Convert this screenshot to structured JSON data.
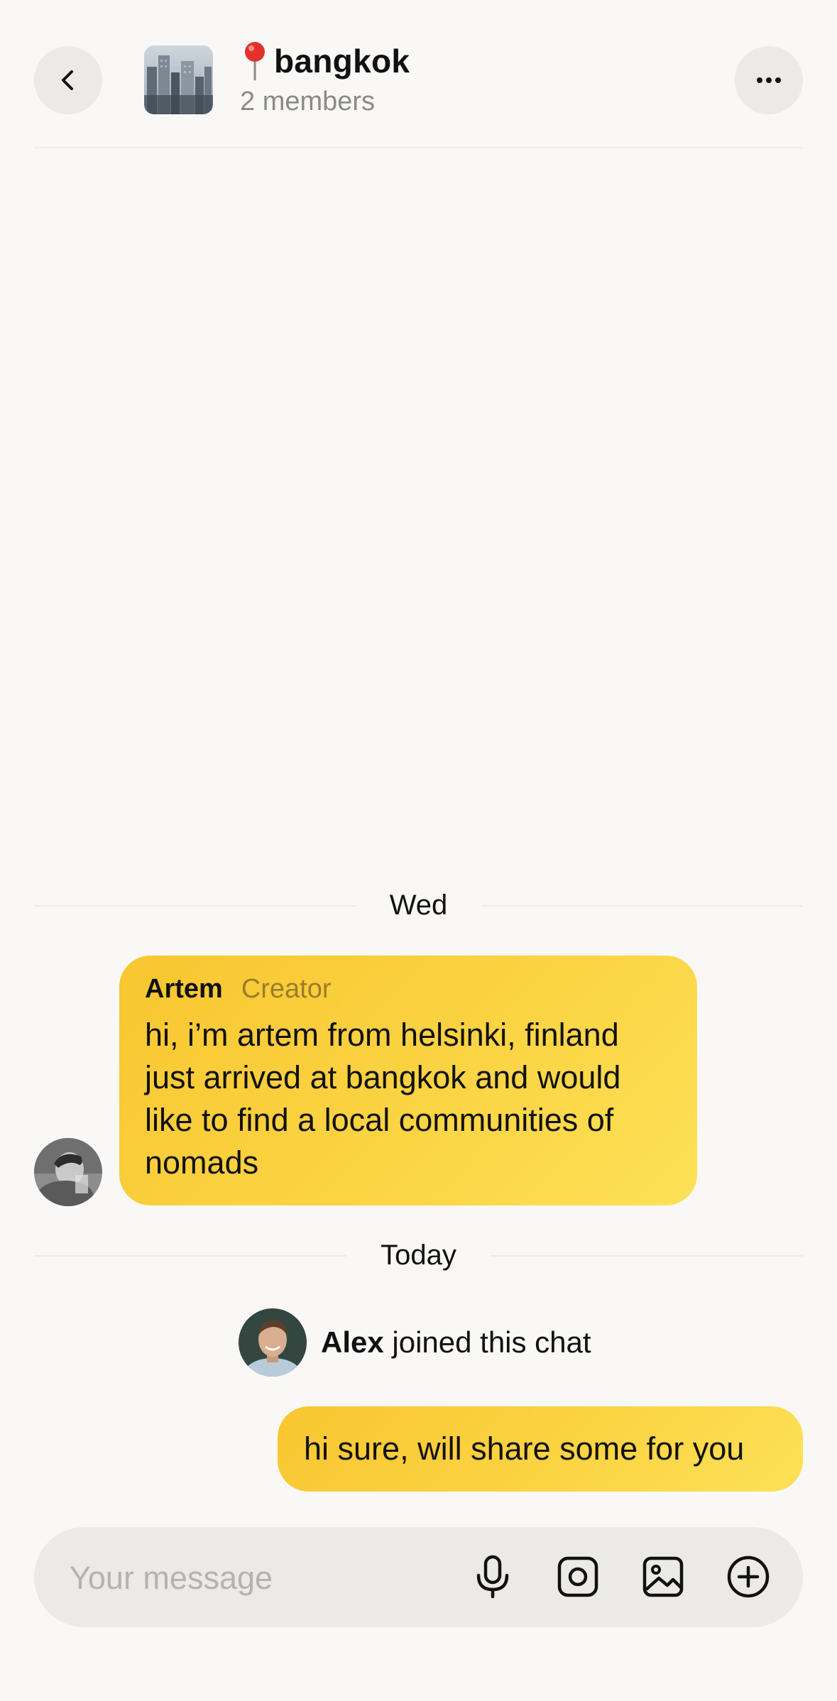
{
  "header": {
    "title": "bangkok",
    "title_emoji_icon": "round-pushpin-icon",
    "members": "2 members",
    "back_icon": "chevron-left-icon",
    "more_icon": "more-horizontal-icon"
  },
  "messages": {
    "date_wed": "Wed",
    "artem": {
      "name": "Artem",
      "role": "Creator",
      "text_lines": [
        "hi, i’m artem from helsinki, finland",
        "just arrived at bangkok and would",
        "like to find a local communities of",
        "nomads"
      ]
    },
    "date_today": "Today",
    "join": {
      "name": "Alex",
      "action": " joined this chat"
    },
    "mine": {
      "text": "hi sure, will share some for you"
    }
  },
  "composer": {
    "placeholder": "Your message",
    "icons": [
      "microphone-icon",
      "camera-icon",
      "gallery-icon",
      "plus-circle-icon"
    ]
  },
  "colors": {
    "background": "#f9f8f6",
    "bubble": "#fbd545",
    "button_bg": "#ebeae8",
    "secondary_text": "#8a8a8a"
  }
}
